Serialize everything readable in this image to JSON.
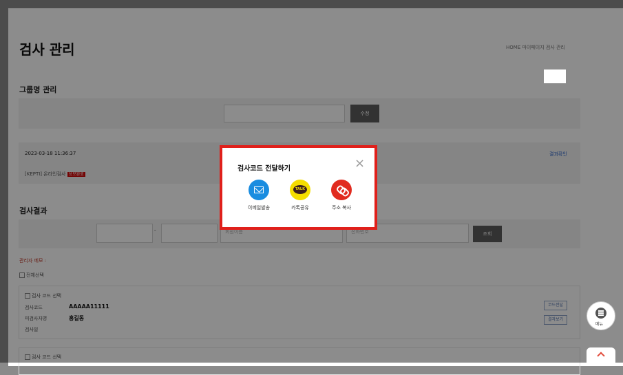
{
  "header": {
    "title": "검사 관리",
    "breadcrumb": "HOME 마이페이지 검사 관리"
  },
  "group_section": {
    "title": "그룹명 관리",
    "input_value": "",
    "edit_button": "수정"
  },
  "record": {
    "datetime": "2023-03-18 11:36:37",
    "test_name": "[KEPTI] 온라인검사",
    "badge": "응모완료",
    "link": "결과확인"
  },
  "results_section": {
    "title": "검사결과",
    "search_placeholder_1": "회원이름",
    "search_placeholder_2": "전화번호",
    "search_button": "조회",
    "note": "관리자 메모 :",
    "select_all": "전체선택"
  },
  "result_item": {
    "checkbox_label": "검사 코드 선택",
    "code_label": "검사코드",
    "code_value": "AAAAA11111",
    "name_label": "피검사자명",
    "name_value": "홍길동",
    "status_label": "검사일",
    "code_send_button": "코드전달",
    "result_button": "결과보기"
  },
  "result_item_2": {
    "checkbox_label": "검사 코드 선택"
  },
  "floating": {
    "menu_label": "메뉴",
    "menu_icon": "list-icon",
    "top_icon": "chevron-up-icon"
  },
  "modal": {
    "title": "검사코드 전달하기",
    "options": [
      {
        "label": "이메일발송",
        "icon": "mail-icon",
        "color": "#1a8de0"
      },
      {
        "label": "카톡공유",
        "icon": "kakao-talk-icon",
        "color": "#f5dd00"
      },
      {
        "label": "주소 복사",
        "icon": "link-icon",
        "color": "#e12b1f"
      }
    ],
    "kakao_text": "TALK"
  }
}
